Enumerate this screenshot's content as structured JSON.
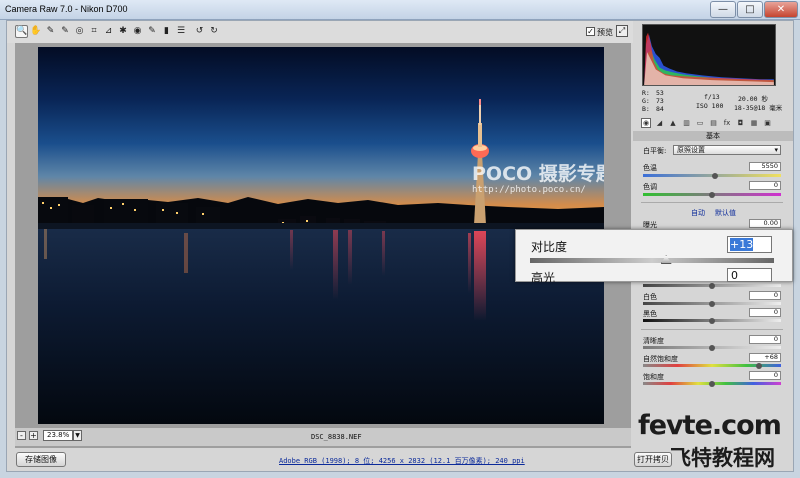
{
  "window": {
    "title": "Camera Raw 7.0 - Nikon D700",
    "minimize": "—",
    "maximize": "□",
    "close": "✕"
  },
  "toolbar": {
    "tools": [
      {
        "icon": "zoom-icon",
        "glyph": "🔍"
      },
      {
        "icon": "hand-icon",
        "glyph": "✋"
      },
      {
        "icon": "white-balance-icon",
        "glyph": "✎"
      },
      {
        "icon": "color-sampler-icon",
        "glyph": "✎"
      },
      {
        "icon": "target-adjust-icon",
        "glyph": "◎"
      },
      {
        "icon": "crop-icon",
        "glyph": "⌗"
      },
      {
        "icon": "straighten-icon",
        "glyph": "⊿"
      },
      {
        "icon": "spot-removal-icon",
        "glyph": "✱"
      },
      {
        "icon": "red-eye-icon",
        "glyph": "◉"
      },
      {
        "icon": "adjustment-brush-icon",
        "glyph": "✎"
      },
      {
        "icon": "graduated-filter-icon",
        "glyph": "▮"
      },
      {
        "icon": "preferences-icon",
        "glyph": "☰"
      },
      {
        "icon": "rotate-left-icon",
        "glyph": "↺"
      },
      {
        "icon": "rotate-right-icon",
        "glyph": "↻"
      }
    ],
    "preview_checked": "✓",
    "preview_label": "预览",
    "fullscreen_glyph": "⤢"
  },
  "photo": {
    "watermark_logo": "POCO 摄影专题",
    "watermark_url": "http://photo.poco.cn/"
  },
  "status": {
    "zoom_minus": "-",
    "zoom_plus": "+",
    "zoom_value": "23.8%",
    "zoom_arrow": "▼",
    "filename": "DSC_8838.NEF"
  },
  "footer": {
    "save_button": "存储图像",
    "workflow_link": "Adobe RGB (1998); 8 位; 4256 x 2832 (12.1 百万像素); 240 ppi",
    "open_button": "打开拷贝"
  },
  "histogram_data": {
    "colors": {
      "red": "#ff3030",
      "green": "#30e030",
      "blue": "#3060ff",
      "white": "#ffffff"
    }
  },
  "readout": {
    "r_label": "R:",
    "r_value": "53",
    "g_label": "G:",
    "g_value": "73",
    "b_label": "B:",
    "b_value": "84",
    "aperture": "f/13",
    "shutter": "20.00 秒",
    "iso": "ISO 100",
    "lens": "18-35@18 毫米"
  },
  "panel": {
    "tabs": [
      {
        "icon": "basic-icon",
        "glyph": "◉"
      },
      {
        "icon": "tone-curve-icon",
        "glyph": "◢"
      },
      {
        "icon": "detail-icon",
        "glyph": "▲"
      },
      {
        "icon": "hsl-icon",
        "glyph": "▥"
      },
      {
        "icon": "split-toning-icon",
        "glyph": "▭"
      },
      {
        "icon": "lens-corrections-icon",
        "glyph": "▤"
      },
      {
        "icon": "effects-icon",
        "glyph": "fx"
      },
      {
        "icon": "camera-calibration-icon",
        "glyph": "◘"
      },
      {
        "icon": "presets-icon",
        "glyph": "▦"
      },
      {
        "icon": "snapshots-icon",
        "glyph": "▣"
      }
    ],
    "title": "基本",
    "wb_label": "白平衡:",
    "wb_value": "原照设置",
    "wb_arrow": "▾",
    "temp_label": "色温",
    "temp_value": "5550",
    "tint_label": "色调",
    "tint_value": "0",
    "auto_link": "自动",
    "default_link": "默认值",
    "exposure_label": "曝光",
    "exposure_value": "0.00",
    "whites_label": "白色",
    "whites_value": "0",
    "blacks_label": "黑色",
    "blacks_value": "0",
    "clarity_label": "清晰度",
    "clarity_value": "0",
    "vibrance_label": "自然饱和度",
    "vibrance_value": "+68",
    "saturation_label": "饱和度",
    "saturation_value": "0"
  },
  "callout": {
    "label": "对比度",
    "value": "+13",
    "slider_fraction": 0.56,
    "next_label": "高光",
    "next_value": "0"
  },
  "slider_levels": {
    "temp": 0.52,
    "tint": 0.5,
    "exposure": 0.5,
    "whites": 0.5,
    "blacks": 0.5,
    "clarity": 0.5,
    "vibrance": 0.84,
    "saturation": 0.5
  },
  "brand": {
    "en": "fevte.com",
    "cn": "飞特教程网"
  }
}
